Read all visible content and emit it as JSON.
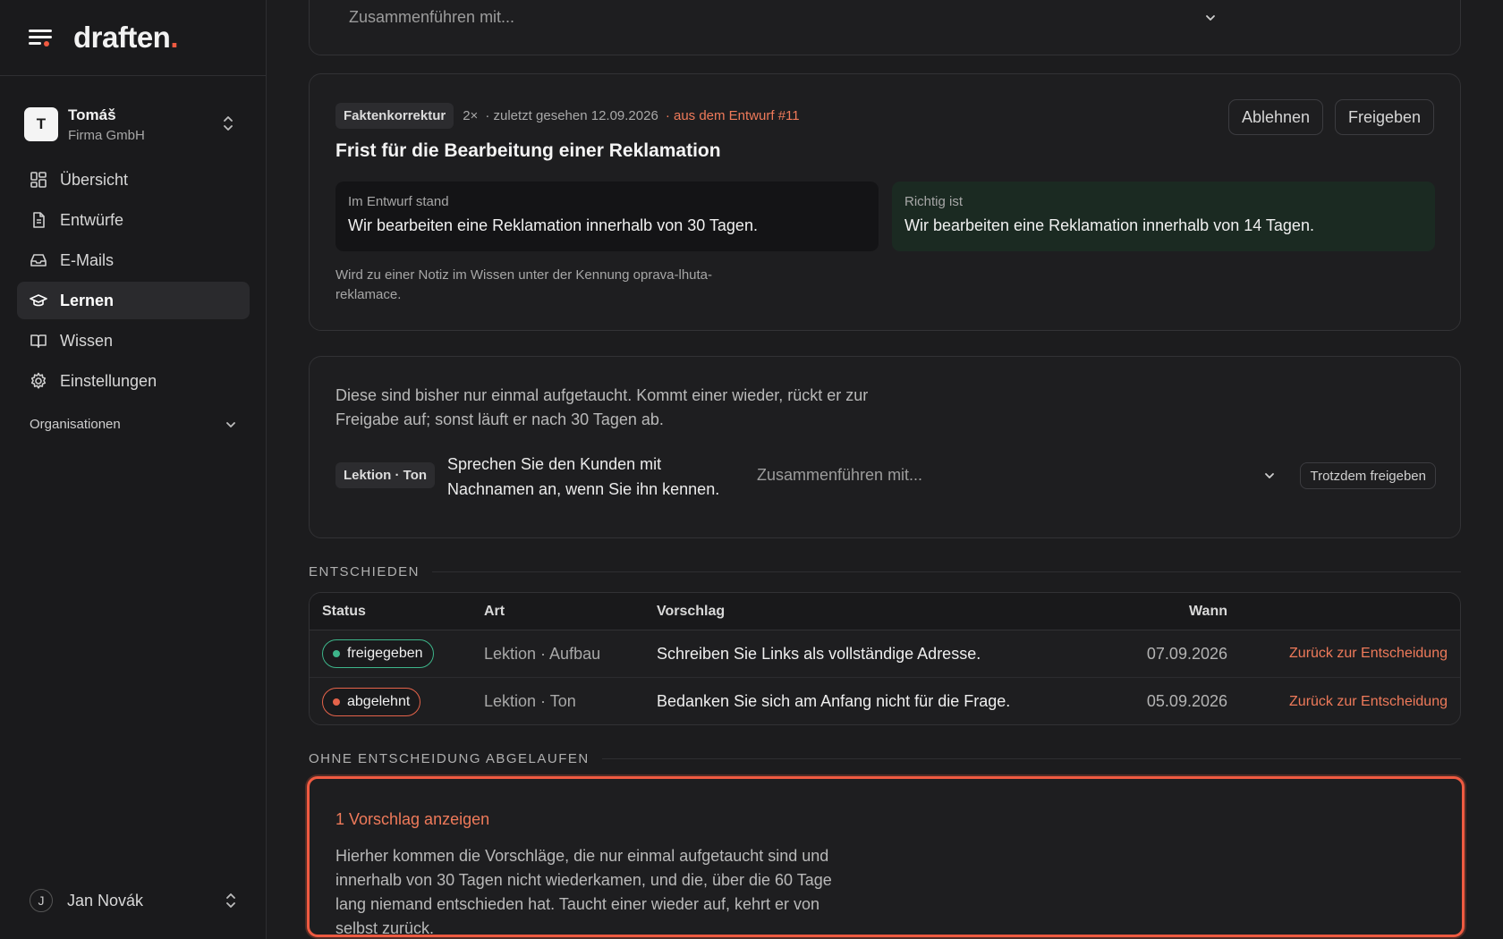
{
  "brand": {
    "name": "draften",
    "dot": "."
  },
  "account": {
    "initial": "T",
    "name": "Tomáš",
    "company": "Firma GmbH"
  },
  "nav": [
    {
      "label": "Übersicht",
      "icon": "grid-icon"
    },
    {
      "label": "Entwürfe",
      "icon": "document-icon"
    },
    {
      "label": "E-Mails",
      "icon": "inbox-icon"
    },
    {
      "label": "Lernen",
      "icon": "graduation-cap-icon",
      "active": true
    },
    {
      "label": "Wissen",
      "icon": "book-icon"
    },
    {
      "label": "Einstellungen",
      "icon": "gear-icon"
    }
  ],
  "organisations": {
    "label": "Organisationen"
  },
  "user": {
    "initial": "J",
    "name": "Jan Novák"
  },
  "top_card": {
    "merge_placeholder": "Zusammenführen mit..."
  },
  "fact_card": {
    "tag": "Faktenkorrektur",
    "count": "2×",
    "last_seen": "· zuletzt gesehen 12.09.2026",
    "source": "· aus dem Entwurf #11",
    "reject_label": "Ablehnen",
    "approve_label": "Freigeben",
    "title": "Frist für die Bearbeitung einer Reklamation",
    "old_label": "Im Entwurf stand",
    "old_text": "Wir bearbeiten eine Reklamation innerhalb von 30 Tagen.",
    "new_label": "Richtig ist",
    "new_text": "Wir bearbeiten eine Reklamation innerhalb von 14 Tagen.",
    "note": "Wird zu einer Notiz im Wissen unter der Kennung oprava-lhuta-reklamace."
  },
  "once_card": {
    "description": "Diese sind bisher nur einmal aufgetaucht. Kommt einer wieder, rückt er zur Freigabe auf; sonst läuft er nach 30 Tagen ab.",
    "tag": "Lektion · Ton",
    "text": "Sprechen Sie den Kunden mit Nachnamen an, wenn Sie ihn kennen.",
    "merge_placeholder": "Zusammenführen mit...",
    "force_approve_label": "Trotzdem freigeben"
  },
  "decided": {
    "heading": "ENTSCHIEDEN",
    "columns": {
      "status": "Status",
      "art": "Art",
      "vorschlag": "Vorschlag",
      "wann": "Wann"
    },
    "rows": [
      {
        "status": "freigegeben",
        "art": "Lektion · Aufbau",
        "vorschlag": "Schreiben Sie Links als vollständige Adresse.",
        "wann": "07.09.2026",
        "action": "Zurück zur Entscheidung"
      },
      {
        "status": "abgelehnt",
        "art": "Lektion · Ton",
        "vorschlag": "Bedanken Sie sich am Anfang nicht für die Frage.",
        "wann": "05.09.2026",
        "action": "Zurück zur Entscheidung"
      }
    ]
  },
  "expired": {
    "heading": "OHNE ENTSCHEIDUNG ABGELAUFEN",
    "link": "1 Vorschlag anzeigen",
    "description": "Hierher kommen die Vorschläge, die nur einmal aufgetaucht sind und innerhalb von 30 Tagen nicht wiederkamen, und die, über die 60 Tage lang niemand entschieden hat. Taucht einer wieder auf, kehrt er von selbst zurück."
  },
  "colors": {
    "accent": "#ef5a41",
    "approved": "#3db58a",
    "rejected": "#e5634a",
    "background": "#1c1c1e"
  }
}
